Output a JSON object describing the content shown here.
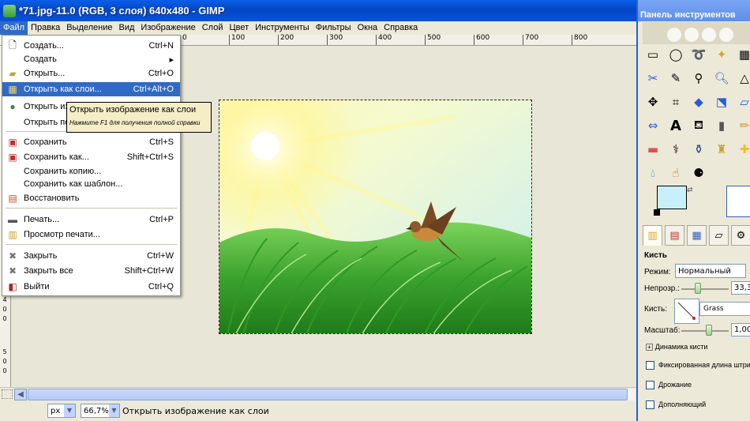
{
  "window": {
    "title": "*71.jpg-11.0 (RGB, 3 слоя) 640x480 - GIMP"
  },
  "menubar": [
    "Файл",
    "Правка",
    "Выделение",
    "Вид",
    "Изображение",
    "Слой",
    "Цвет",
    "Инструменты",
    "Фильтры",
    "Окна",
    "Справка"
  ],
  "ruler": {
    "h": [
      "0",
      "100",
      "200",
      "300",
      "400",
      "500",
      "600",
      "700",
      "800"
    ],
    "v": [
      "4",
      "0",
      "0",
      "5",
      "0",
      "0"
    ]
  },
  "file_menu": {
    "items": [
      {
        "label": "Создать...",
        "shortcut": "Ctrl+N",
        "icon": "new-document-icon"
      },
      {
        "label": "Создать",
        "shortcut": "▸",
        "icon": ""
      },
      {
        "label": "Открыть...",
        "shortcut": "Ctrl+O",
        "icon": "open-folder-icon"
      },
      {
        "label": "Открыть как слои...",
        "shortcut": "Ctrl+Alt+O",
        "icon": "open-as-layers-icon"
      },
      {
        "label": "Открыть из",
        "shortcut": "",
        "icon": "globe-icon"
      },
      {
        "label": "Открыть по",
        "shortcut": "",
        "icon": ""
      },
      {
        "label": "Сохранить",
        "shortcut": "Ctrl+S",
        "icon": "save-icon"
      },
      {
        "label": "Сохранить как...",
        "shortcut": "Shift+Ctrl+S",
        "icon": "save-as-icon"
      },
      {
        "label": "Сохранить копию...",
        "shortcut": "",
        "icon": ""
      },
      {
        "label": "Сохранить как шаблон...",
        "shortcut": "",
        "icon": ""
      },
      {
        "label": "Восстановить",
        "shortcut": "",
        "icon": "revert-icon"
      },
      {
        "label": "Печать...",
        "shortcut": "Ctrl+P",
        "icon": "print-icon"
      },
      {
        "label": "Просмотр печати...",
        "shortcut": "",
        "icon": "print-preview-icon"
      },
      {
        "label": "Закрыть",
        "shortcut": "Ctrl+W",
        "icon": "close-icon"
      },
      {
        "label": "Закрыть все",
        "shortcut": "Shift+Ctrl+W",
        "icon": "close-all-icon"
      },
      {
        "label": "Выйти",
        "shortcut": "Ctrl+Q",
        "icon": "quit-icon"
      }
    ]
  },
  "tooltip": {
    "title": "Открыть изображение как слои",
    "hint": "Нажмите F1 для получения полной справки"
  },
  "statusbar": {
    "unit": "px",
    "zoom": "66,7%",
    "message": "Открыть изображение как слои"
  },
  "toolbox": {
    "title": "Панель инструментов",
    "tools": [
      "rect-select-icon",
      "ellipse-select-icon",
      "lasso-icon",
      "fuzzy-select-icon",
      "select-by-color-icon",
      "scissors-icon",
      "paths-icon",
      "color-picker-icon",
      "zoom-icon",
      "measure-icon",
      "move-icon",
      "crop-icon",
      "rotate-icon",
      "scale-icon",
      "shear-icon",
      "flip-icon",
      "text-icon",
      "bucket-fill-icon",
      "blend-icon",
      "pencil-icon",
      "eraser-icon",
      "airbrush-icon",
      "ink-icon",
      "clone-icon",
      "heal-icon",
      "blur-icon",
      "smudge-icon",
      "dodge-burn-icon"
    ],
    "fg_color": "#C8F0FA",
    "bg_color": "#FFFFFF"
  },
  "tool_options": {
    "title": "Кисть",
    "mode_label": "Режим:",
    "mode_value": "Нормальный",
    "opacity_label": "Непрозр.:",
    "opacity_value": "33,3",
    "brush_label": "Кисть:",
    "brush_value": "Grass",
    "scale_label": "Масштаб:",
    "scale_value": "1,00",
    "dynamics_label": "Динамика кисти",
    "checks": [
      "Фиксированная длина штриха",
      "Дрожание",
      "Дополняющий"
    ]
  }
}
